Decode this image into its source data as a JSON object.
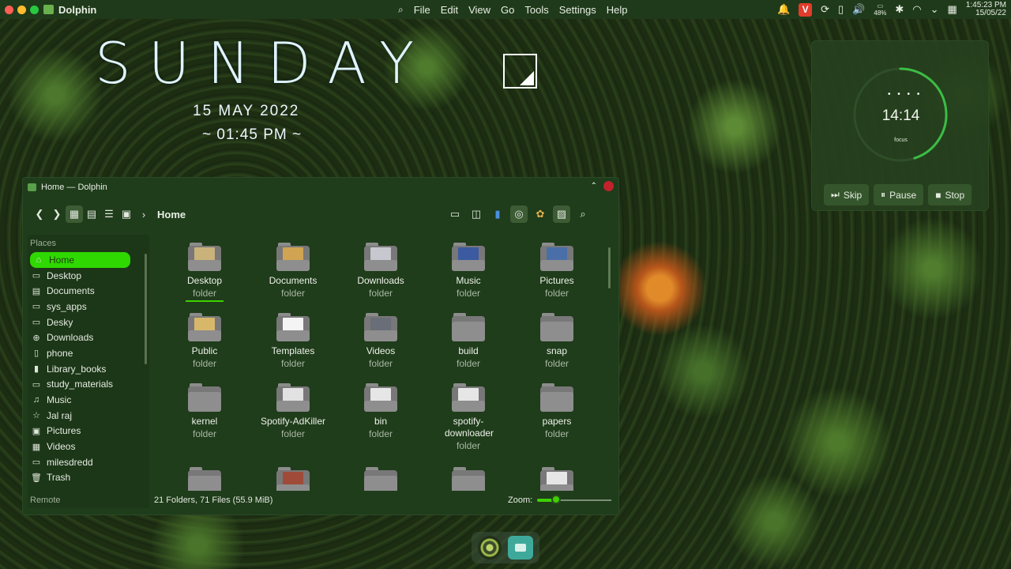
{
  "menubar": {
    "app_name": "Dolphin",
    "menus": [
      "File",
      "Edit",
      "View",
      "Go",
      "Tools",
      "Settings",
      "Help"
    ],
    "battery": "48%",
    "clock_time": "1:45:23 PM",
    "clock_date": "15/05/22",
    "colors": {
      "close": "#ff5f57",
      "minimize": "#febc2e",
      "maximize": "#28c840"
    }
  },
  "desktop": {
    "day": "SUNDAY",
    "date": "15 MAY 2022",
    "time": "~ 01:45 PM ~"
  },
  "pomodoro": {
    "time": "14:14",
    "label": "focus",
    "progress": 0.45,
    "buttons": {
      "skip": "Skip",
      "pause": "Pause",
      "stop": "Stop"
    }
  },
  "window": {
    "title": "Home — Dolphin",
    "breadcrumb": "Home",
    "places_header": "Places",
    "remote_header": "Remote",
    "places": [
      {
        "label": "Home",
        "icon": "home-icon",
        "glyph": "⌂"
      },
      {
        "label": "Desktop",
        "icon": "desktop-icon",
        "glyph": "▭"
      },
      {
        "label": "Documents",
        "icon": "documents-icon",
        "glyph": "▤"
      },
      {
        "label": "sys_apps",
        "icon": "folder-icon",
        "glyph": "▭"
      },
      {
        "label": "Desky",
        "icon": "monitor-icon",
        "glyph": "▭"
      },
      {
        "label": "Downloads",
        "icon": "download-icon",
        "glyph": "⊕"
      },
      {
        "label": "phone",
        "icon": "phone-icon",
        "glyph": "▯"
      },
      {
        "label": "Library_books",
        "icon": "book-icon",
        "glyph": "▮"
      },
      {
        "label": "study_materials",
        "icon": "folder-icon",
        "glyph": "▭"
      },
      {
        "label": "Music",
        "icon": "music-icon",
        "glyph": "♫"
      },
      {
        "label": "Jal raj",
        "icon": "star-icon",
        "glyph": "☆"
      },
      {
        "label": "Pictures",
        "icon": "pictures-icon",
        "glyph": "▣"
      },
      {
        "label": "Videos",
        "icon": "videos-icon",
        "glyph": "▦"
      },
      {
        "label": "milesdredd",
        "icon": "folder-icon",
        "glyph": "▭"
      },
      {
        "label": "Trash",
        "icon": "trash-icon",
        "glyph": "🗑"
      }
    ],
    "files": [
      {
        "name": "Desktop",
        "kind": "folder",
        "thumb": "#c9b37a"
      },
      {
        "name": "Documents",
        "kind": "folder",
        "thumb": "#d0a452"
      },
      {
        "name": "Downloads",
        "kind": "folder",
        "thumb": "#c7c7d0"
      },
      {
        "name": "Music",
        "kind": "folder",
        "thumb": "#3b5aa0"
      },
      {
        "name": "Pictures",
        "kind": "folder",
        "thumb": "#4a6fa8"
      },
      {
        "name": "Public",
        "kind": "folder",
        "thumb": "#d7b86a"
      },
      {
        "name": "Templates",
        "kind": "folder",
        "thumb": "#f4f4f4"
      },
      {
        "name": "Videos",
        "kind": "folder",
        "thumb": "#6a6e78"
      },
      {
        "name": "build",
        "kind": "folder",
        "thumb": ""
      },
      {
        "name": "snap",
        "kind": "folder",
        "thumb": ""
      },
      {
        "name": "kernel",
        "kind": "folder",
        "thumb": ""
      },
      {
        "name": "Spotify-AdKiller",
        "kind": "folder",
        "thumb": "#e2e2e2"
      },
      {
        "name": "bin",
        "kind": "folder",
        "thumb": "#e6e6e6"
      },
      {
        "name": "spotify-downloader",
        "kind": "folder",
        "thumb": "#e6e6e6"
      },
      {
        "name": "papers",
        "kind": "folder",
        "thumb": ""
      },
      {
        "name": "",
        "kind": "",
        "thumb": ""
      },
      {
        "name": "",
        "kind": "",
        "thumb": "#a04a3a"
      },
      {
        "name": "",
        "kind": "",
        "thumb": ""
      },
      {
        "name": "",
        "kind": "",
        "thumb": ""
      },
      {
        "name": "",
        "kind": "",
        "thumb": "#e6e6e6"
      }
    ],
    "status": "21 Folders, 71 Files (55.9 MiB)",
    "zoom_label": "Zoom:",
    "zoom_level": 0.25
  }
}
